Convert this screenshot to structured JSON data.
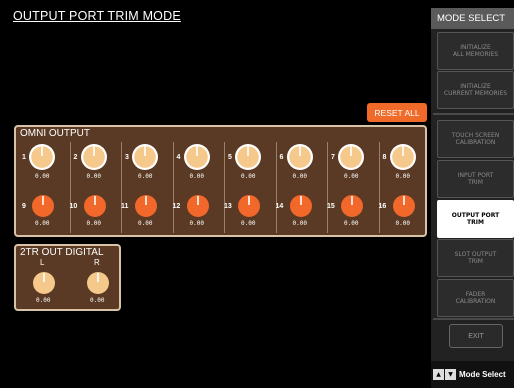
{
  "title": "OUTPUT PORT TRIM MODE",
  "reset_all": "RESET ALL",
  "omni": {
    "title": "OMNI OUTPUT",
    "knobs": [
      {
        "n": "1",
        "value": "0.00"
      },
      {
        "n": "2",
        "value": "0.00"
      },
      {
        "n": "3",
        "value": "0.00"
      },
      {
        "n": "4",
        "value": "0.00"
      },
      {
        "n": "5",
        "value": "0.00"
      },
      {
        "n": "6",
        "value": "0.00"
      },
      {
        "n": "7",
        "value": "0.00"
      },
      {
        "n": "8",
        "value": "0.00"
      },
      {
        "n": "9",
        "value": "0.00"
      },
      {
        "n": "10",
        "value": "0.00"
      },
      {
        "n": "11",
        "value": "0.00"
      },
      {
        "n": "12",
        "value": "0.00"
      },
      {
        "n": "13",
        "value": "0.00"
      },
      {
        "n": "14",
        "value": "0.00"
      },
      {
        "n": "15",
        "value": "0.00"
      },
      {
        "n": "16",
        "value": "0.00"
      }
    ]
  },
  "tr": {
    "title": "2TR OUT DIGITAL",
    "knobs": [
      {
        "label": "L",
        "value": "0.00"
      },
      {
        "label": "R",
        "value": "0.00"
      }
    ]
  },
  "sidebar": {
    "title": "MODE SELECT",
    "buttons": [
      {
        "label": "INITIALIZE\nALL MEMORIES",
        "selected": false
      },
      {
        "label": "INITIALIZE\nCURRENT MEMORIES",
        "selected": false
      },
      {
        "label": "TOUCH SCREEN\nCALIBRATION",
        "selected": false
      },
      {
        "label": "INPUT PORT\nTRIM",
        "selected": false
      },
      {
        "label": "OUTPUT PORT\nTRIM",
        "selected": true
      },
      {
        "label": "SLOT OUTPUT\nTRIM",
        "selected": false
      },
      {
        "label": "FADER\nCALIBRATION",
        "selected": false
      }
    ],
    "exit": "EXIT",
    "mode_select": "Mode Select"
  },
  "colors": {
    "panel_bg": "#5a3a24",
    "panel_border": "#d9c3a6",
    "knob_white_ring": "#ffffff",
    "knob_peach": "#f5c88c",
    "knob_orange": "#f2672a",
    "accent": "#f06a2a"
  }
}
